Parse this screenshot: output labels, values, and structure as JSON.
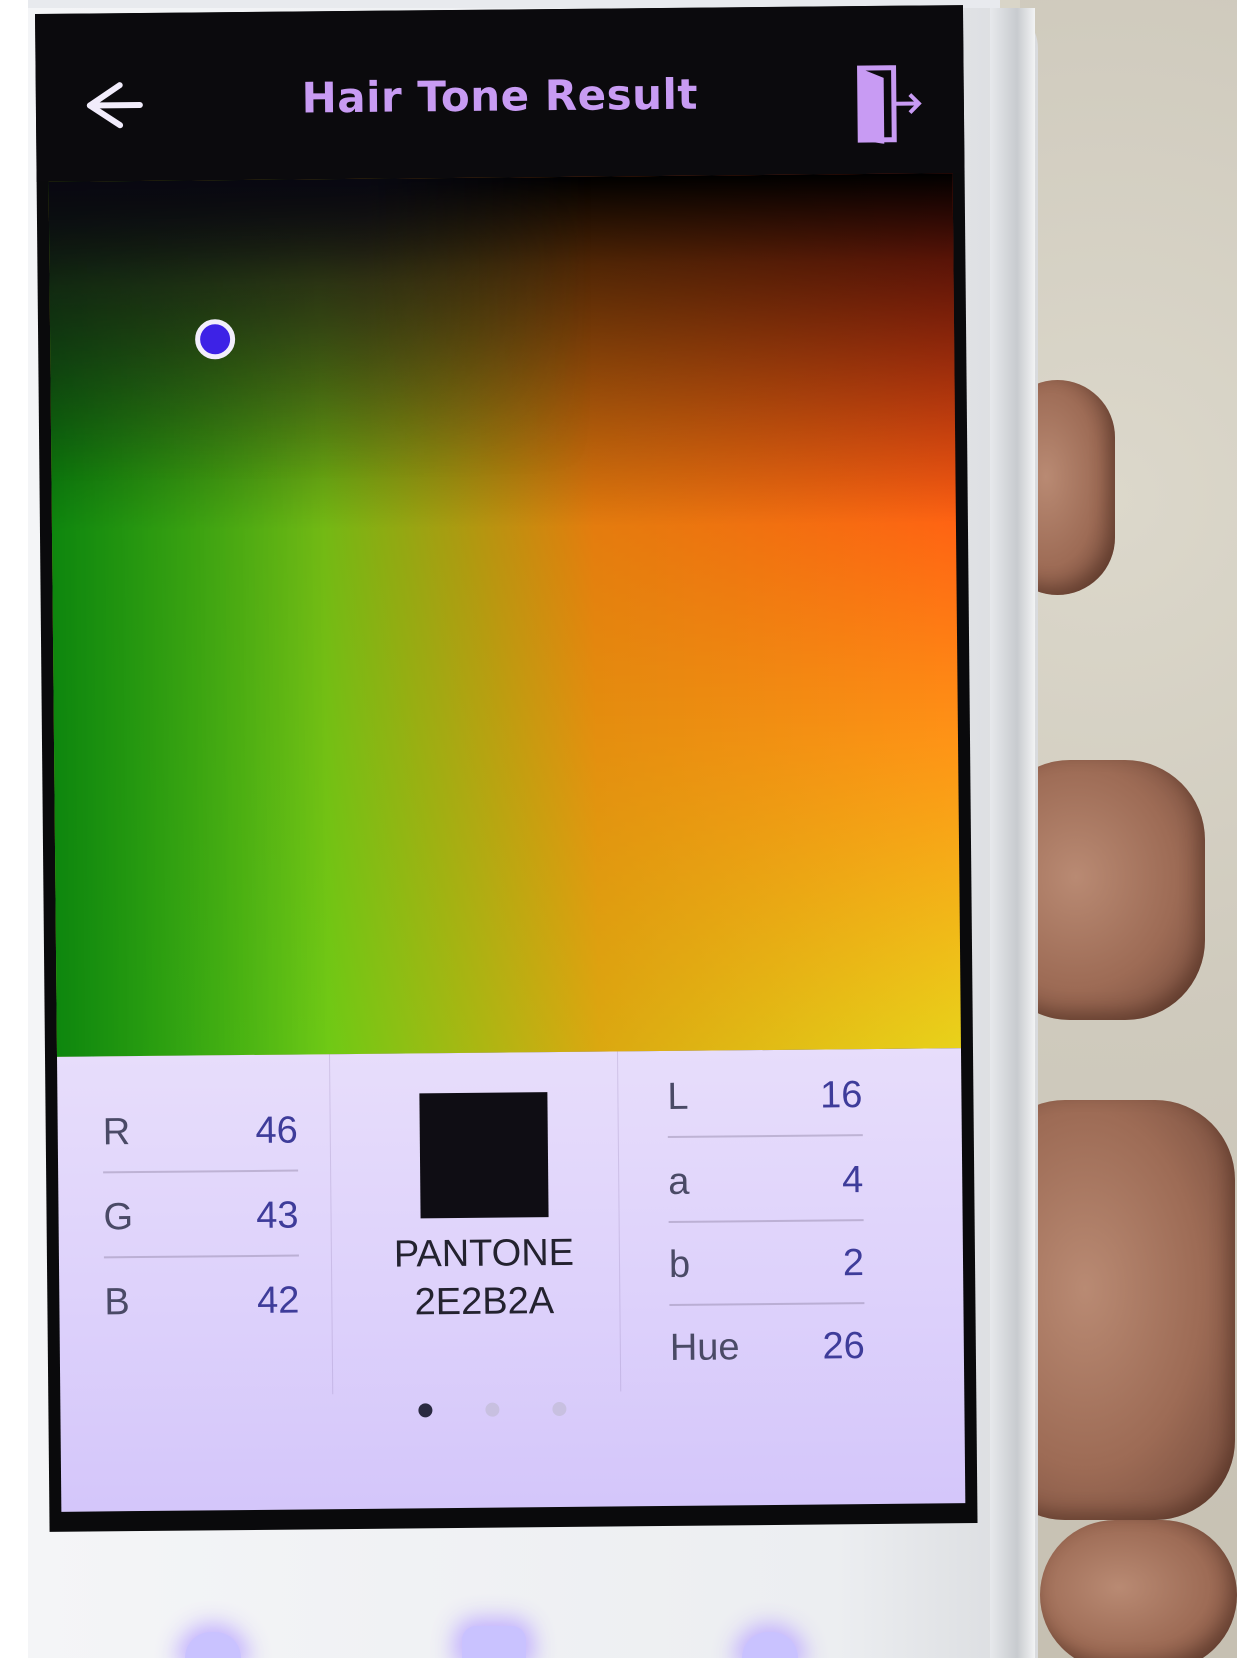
{
  "app_bar": {
    "title": "Hair Tone Result",
    "back_icon": "back-arrow-icon",
    "exit_icon": "exit-door-icon"
  },
  "colors": {
    "title": "#c89bf3",
    "marker": "#3d22e6",
    "swatch": "#2E2B2A",
    "page_indicator_active": "#2a2a40",
    "page_indicator_inactive": "#c8c0e0"
  },
  "rgb": {
    "r_label": "R",
    "r_value": "46",
    "g_label": "G",
    "g_value": "43",
    "b_label": "B",
    "b_value": "42"
  },
  "pantone": {
    "label": "PANTONE",
    "code": "2E2B2A"
  },
  "lab": {
    "l_label": "L",
    "l_value": "16",
    "a_label": "a",
    "a_value": "4",
    "b_label": "b",
    "b_value": "2",
    "hue_label": "Hue",
    "hue_value": "26"
  },
  "pager": {
    "pages": 3,
    "active_index": 0
  },
  "system_nav": {
    "icons": [
      "recent-apps-icon",
      "home-icon",
      "system-back-icon"
    ]
  }
}
